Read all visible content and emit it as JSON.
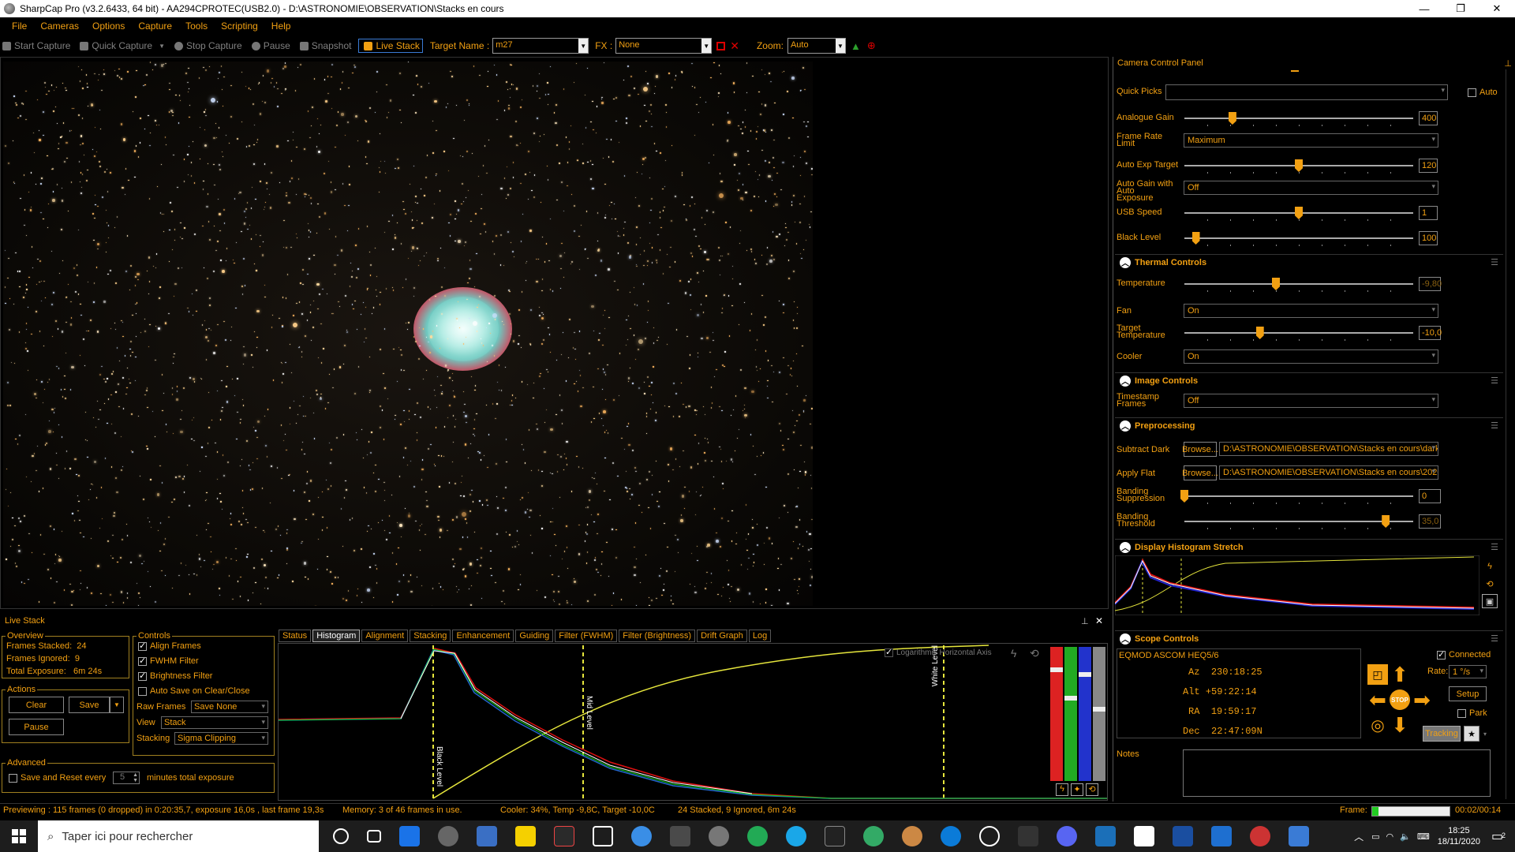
{
  "window": {
    "title": "SharpCap Pro (v3.2.6433, 64 bit) - AA294CPROTEC(USB2.0) - D:\\ASTRONOMIE\\OBSERVATION\\Stacks en cours",
    "minimize": "—",
    "restore": "❐",
    "close": "✕"
  },
  "menu": [
    "File",
    "Cameras",
    "Options",
    "Capture",
    "Tools",
    "Scripting",
    "Help"
  ],
  "toolbar": {
    "start_capture": "Start Capture",
    "quick_capture": "Quick Capture",
    "stop_capture": "Stop Capture",
    "pause": "Pause",
    "snapshot": "Snapshot",
    "live_stack": "Live Stack",
    "target_name_label": "Target Name :",
    "target_name_value": "m27",
    "fx_label": "FX :",
    "fx_value": "None",
    "zoom_label": "Zoom:",
    "zoom_value": "Auto"
  },
  "camera_panel": {
    "title": "Camera Control Panel",
    "quick_picks_label": "Quick Picks",
    "quick_picks_value": "",
    "auto_label": "Auto",
    "analogue_gain_label": "Analogue Gain",
    "analogue_gain_value": "400",
    "analogue_gain_level": 0.21,
    "frame_rate_label": "Frame Rate Limit",
    "frame_rate_value": "Maximum",
    "auto_exp_label": "Auto Exp Target",
    "auto_exp_value": "120",
    "auto_exp_level": 0.5,
    "auto_gain_label": "Auto Gain with Auto Exposure",
    "auto_gain_value": "Off",
    "usb_speed_label": "USB Speed",
    "usb_speed_value": "1",
    "usb_speed_level": 0.5,
    "black_level_label": "Black Level",
    "black_level_value": "100",
    "black_level_level": 0.05,
    "thermal": {
      "title": "Thermal Controls",
      "temperature_label": "Temperature",
      "temperature_value": "-9,80",
      "temperature_level": 0.4,
      "fan_label": "Fan",
      "fan_value": "On",
      "target_temp_label": "Target Temperature",
      "target_temp_value": "-10,0",
      "target_temp_level": 0.33,
      "cooler_label": "Cooler",
      "cooler_value": "On"
    },
    "image": {
      "title": "Image Controls",
      "timestamp_label": "Timestamp Frames",
      "timestamp_value": "Off"
    },
    "preprocessing": {
      "title": "Preprocessing",
      "subtract_dark_label": "Subtract Dark",
      "browse": "Browse...",
      "subtract_dark_path": "D:\\ASTRONOMIE\\OBSERVATION\\Stacks en cours\\darks\\AA29...",
      "apply_flat_label": "Apply Flat",
      "apply_flat_path": "D:\\ASTRONOMIE\\OBSERVATION\\Stacks en cours\\2020-11-18\\...",
      "banding_supp_label": "Banding Suppression",
      "banding_supp_value": "0",
      "banding_supp_level": 0.0,
      "banding_thresh_label": "Banding Threshold",
      "banding_thresh_value": "35,0",
      "banding_thresh_level": 0.88
    },
    "histogram_stretch": {
      "title": "Display Histogram Stretch"
    },
    "scope": {
      "title": "Scope Controls",
      "mount": "EQMOD ASCOM HEQ5/6",
      "connected_label": "Connected",
      "az_label": "Az",
      "az_value": "230:18:25",
      "alt_label": "Alt",
      "alt_value": "+59:22:14",
      "ra_label": "RA",
      "ra_value": "19:59:17",
      "dec_label": "Dec",
      "dec_value": "22:47:09N",
      "rate_label": "Rate:",
      "rate_value": "1 °/s",
      "setup": "Setup",
      "park": "Park",
      "tracking": "Tracking",
      "stop": "STOP",
      "notes_label": "Notes"
    }
  },
  "live_stack": {
    "title": "Live Stack",
    "overview_title": "Overview",
    "frames_stacked_label": "Frames Stacked:",
    "frames_stacked": "24",
    "frames_ignored_label": "Frames Ignored:",
    "frames_ignored": "9",
    "total_exposure_label": "Total Exposure:",
    "total_exposure": "6m 24s",
    "actions_title": "Actions",
    "clear": "Clear",
    "save": "Save",
    "pause": "Pause",
    "advanced_title": "Advanced",
    "save_reset_label": "Save and Reset every",
    "save_reset_value": "5",
    "minutes_label": "minutes total exposure",
    "controls_title": "Controls",
    "align_frames": "Align Frames",
    "fwhm_filter": "FWHM Filter",
    "brightness_filter": "Brightness Filter",
    "auto_save": "Auto Save on Clear/Close",
    "raw_frames_label": "Raw Frames",
    "raw_frames_value": "Save None",
    "view_label": "View",
    "view_value": "Stack",
    "stacking_label": "Stacking",
    "stacking_value": "Sigma Clipping",
    "tabs": [
      "Status",
      "Histogram",
      "Alignment",
      "Stacking",
      "Enhancement",
      "Guiding",
      "Filter (FWHM)",
      "Filter (Brightness)",
      "Drift Graph",
      "Log"
    ],
    "logarithmic": "Logarithmic Horizontal Axis",
    "black_level": "Black Level",
    "mid_level": "Mid Level",
    "white_level": "White Level"
  },
  "status": {
    "previewing": "Previewing : 115 frames (0 dropped) in 0:20:35,7, exposure 16,0s , last frame 19,3s",
    "memory": "Memory: 3 of 46 frames in use.",
    "cooler": "Cooler: 34%, Temp -9,8C, Target -10,0C",
    "stacked": "24 Stacked, 9 Ignored, 6m 24s",
    "frame_label": "Frame:",
    "frame_time": "00:02/00:14"
  },
  "taskbar": {
    "search_placeholder": "Taper ici pour rechercher",
    "time": "18:25",
    "date": "18/11/2020",
    "notifications": "2"
  },
  "colors": {
    "accent": "#f2a012",
    "background": "#000000",
    "taskbar": "#1d1d1d"
  }
}
